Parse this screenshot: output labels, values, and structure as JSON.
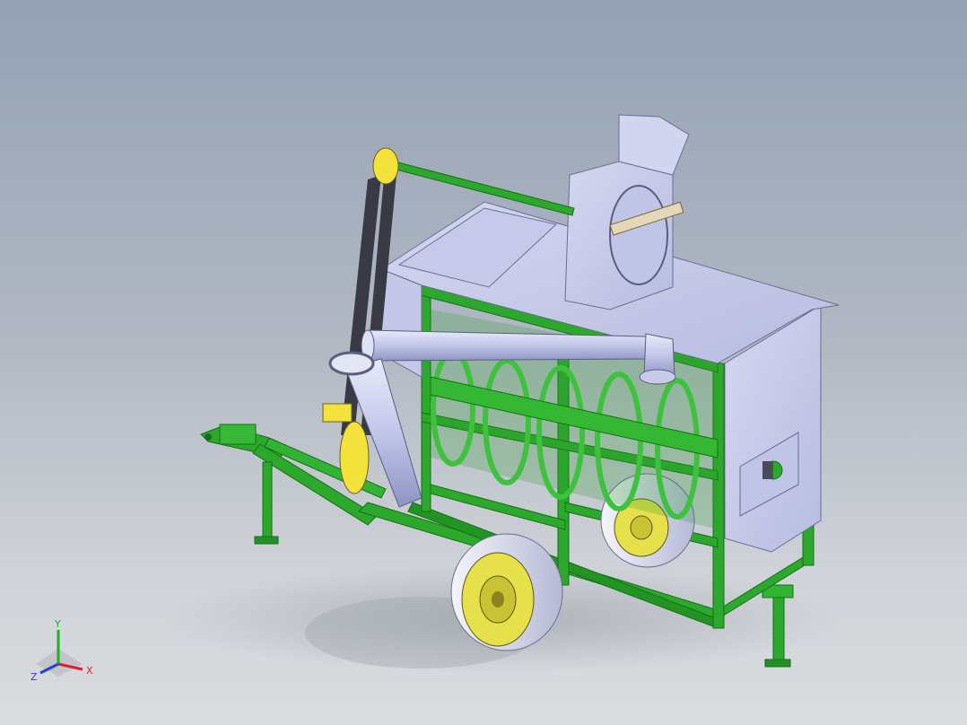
{
  "viewport": {
    "background_top": "#94a1b4",
    "background_bottom": "#dadcdf"
  },
  "model": {
    "frame_color": "#2ca82c",
    "sheet_color": "#c8cbe8",
    "wheel_rim_color": "#e6e04a",
    "tire_color": "#eef0f6",
    "accent_yellow": "#f2e23a"
  },
  "triad": {
    "x_label": "X",
    "y_label": "Y",
    "z_label": "Z",
    "x_color": "#e02020",
    "y_color": "#20b020",
    "z_color": "#2040e0"
  }
}
